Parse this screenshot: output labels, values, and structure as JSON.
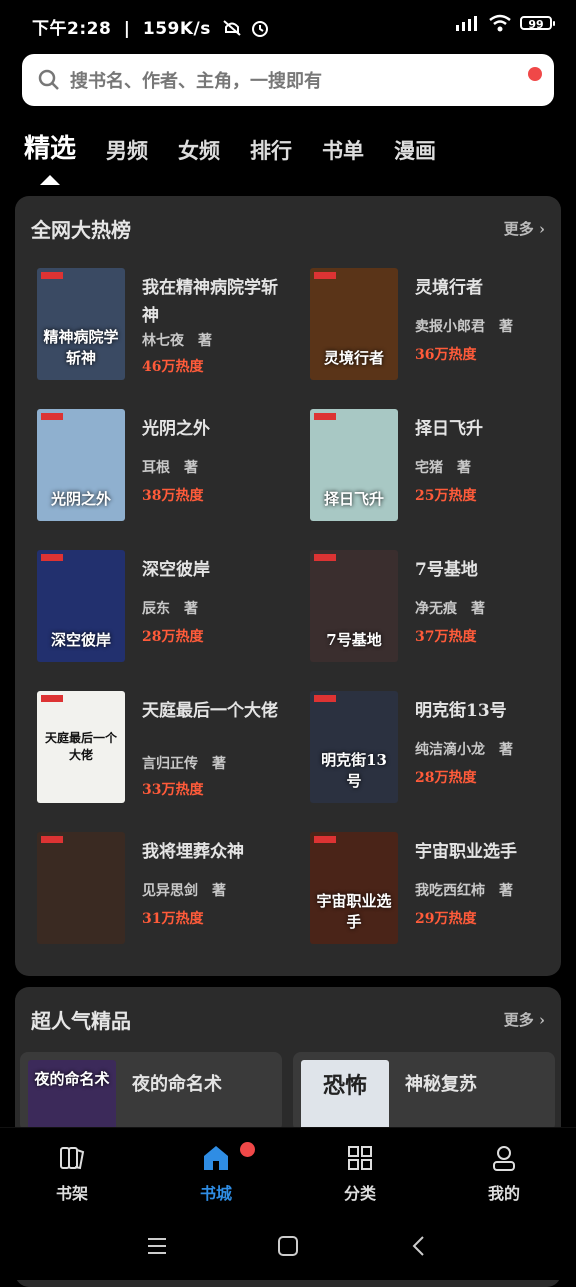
{
  "status": {
    "time": "下午2:28",
    "speed": "159K/s",
    "battery": "99"
  },
  "search": {
    "placeholder": "搜书名、作者、主角，一搜即有"
  },
  "tabs": [
    {
      "label": "精选",
      "active": true
    },
    {
      "label": "男频"
    },
    {
      "label": "女频"
    },
    {
      "label": "排行"
    },
    {
      "label": "书单"
    },
    {
      "label": "漫画"
    }
  ],
  "hot": {
    "title": "全网大热榜",
    "more": "更多",
    "books": [
      {
        "title": "我在精神病院学斩神",
        "author": "林七夜　著",
        "heat": "46万热度",
        "cover_text": "精神病院学斩神",
        "bg": "#3a4a63"
      },
      {
        "title": "灵境行者",
        "author": "卖报小郎君　著",
        "heat": "36万热度",
        "cover_text": "灵境行者",
        "bg": "#5a3418"
      },
      {
        "title": "光阴之外",
        "author": "耳根　著",
        "heat": "38万热度",
        "cover_text": "光阴之外",
        "bg": "#8fb0cf"
      },
      {
        "title": "择日飞升",
        "author": "宅猪　著",
        "heat": "25万热度",
        "cover_text": "择日飞升",
        "bg": "#a8c8c4"
      },
      {
        "title": "深空彼岸",
        "author": "辰东　著",
        "heat": "28万热度",
        "cover_text": "深空彼岸",
        "bg": "#22306e"
      },
      {
        "title": "7号基地",
        "author": "净无痕　著",
        "heat": "37万热度",
        "cover_text": "7号基地",
        "bg": "#3a2e2e"
      },
      {
        "title": "天庭最后一个大佬",
        "author": "言归正传　著",
        "heat": "33万热度",
        "cover_text": "天庭最后一个大佬",
        "bg": "#f2f2ee"
      },
      {
        "title": "明克街13号",
        "author": "纯洁滴小龙　著",
        "heat": "28万热度",
        "cover_text": "明克街13号",
        "bg": "#2b3140"
      },
      {
        "title": "我将埋葬众神",
        "author": "见异思剑　著",
        "heat": "31万热度",
        "cover_text": "",
        "bg": "#3a2a22"
      },
      {
        "title": "宇宙职业选手",
        "author": "我吃西红柿　著",
        "heat": "29万热度",
        "cover_text": "宇宙职业选手",
        "bg": "#4a2418"
      }
    ]
  },
  "popular": {
    "title": "超人气精品",
    "more": "更多",
    "books": [
      {
        "title": "夜的命名术",
        "cover_text": "夜的命名术",
        "bg": "#3c2a5a"
      },
      {
        "title": "神秘复苏",
        "cover_text": "恐怖",
        "bg": "#dfe4ea"
      }
    ]
  },
  "nav": [
    {
      "label": "书架",
      "icon": "bookshelf-icon"
    },
    {
      "label": "书城",
      "icon": "home-icon",
      "active": true
    },
    {
      "label": "分类",
      "icon": "category-icon"
    },
    {
      "label": "我的",
      "icon": "profile-icon"
    }
  ],
  "colors": {
    "accent": "#2f8de4",
    "heat": "#ff5b3a",
    "badge": "#f04848",
    "card": "#2b2b2b"
  }
}
